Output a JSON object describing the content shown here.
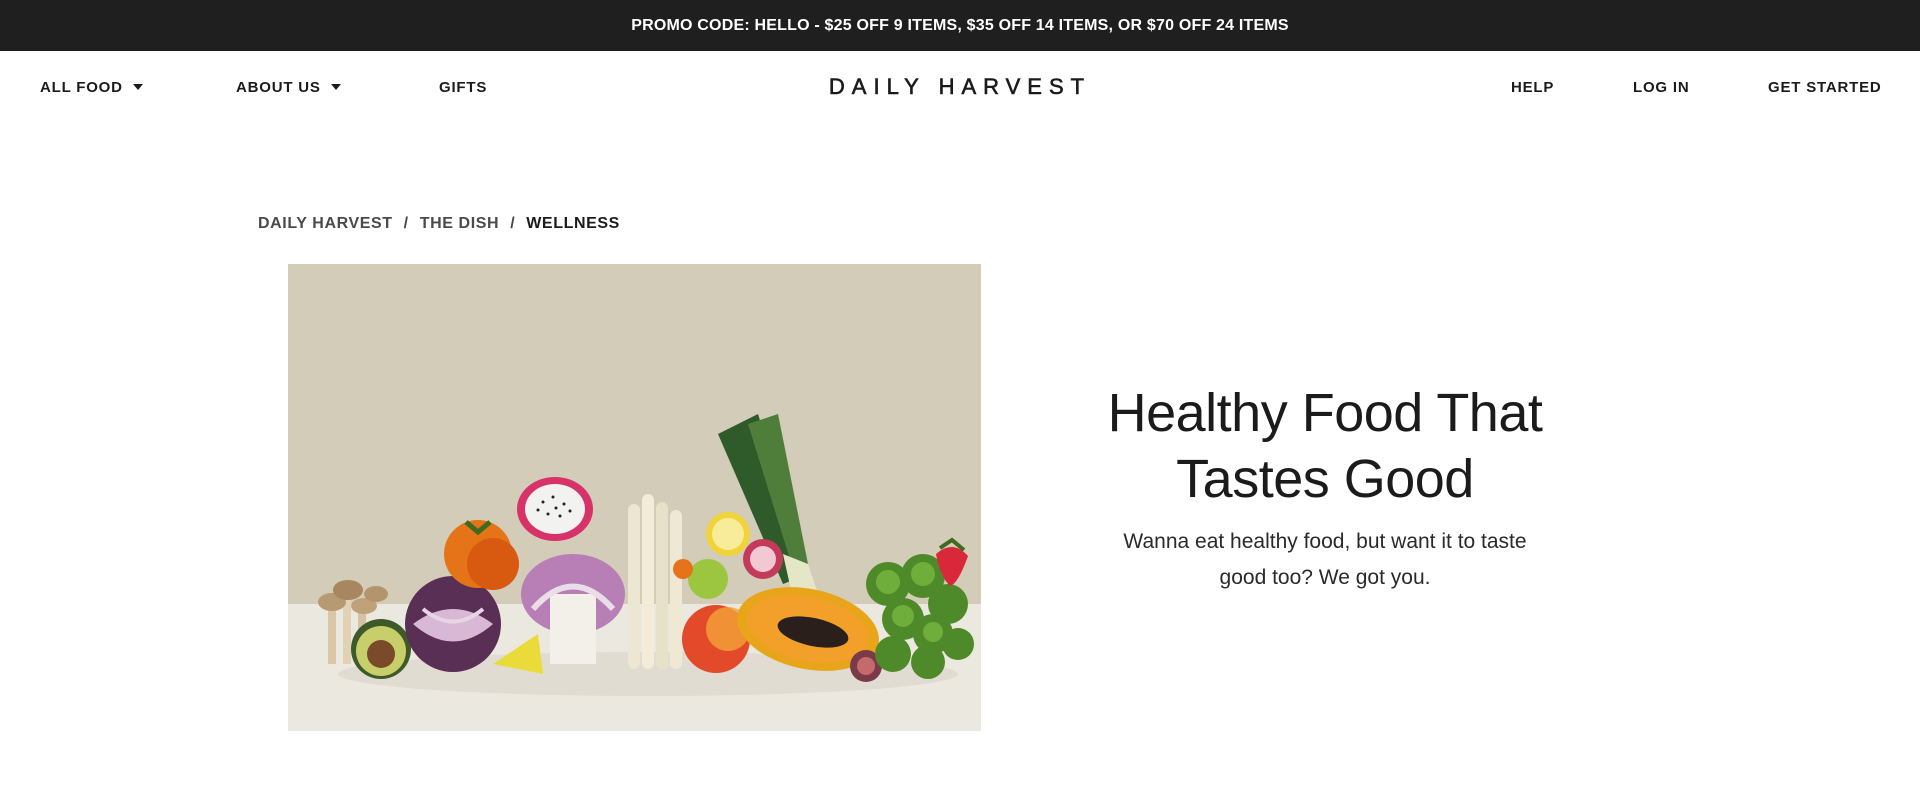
{
  "promo": {
    "text": "PROMO CODE: HELLO - $25 OFF 9 ITEMS, $35 OFF 14 ITEMS, OR $70 OFF 24 ITEMS"
  },
  "nav": {
    "all_food": "ALL FOOD",
    "about_us": "ABOUT US",
    "gifts": "GIFTS",
    "logo": "DAILY HARVEST",
    "help": "HELP",
    "log_in": "LOG IN",
    "get_started": "GET STARTED"
  },
  "breadcrumb": {
    "items": [
      "DAILY HARVEST",
      "THE DISH",
      "WELLNESS"
    ],
    "separator": "/"
  },
  "hero": {
    "title": "Healthy Food That Tastes Good",
    "subtitle": "Wanna eat healthy food, but want it to taste good too? We got you.",
    "image_icon": "produce-arrangement-image"
  },
  "colors": {
    "promo_bg": "#1f1f1f",
    "text": "#1b1b1b",
    "image_bg": "#d2ccb8",
    "image_floor": "#ebe8df"
  }
}
